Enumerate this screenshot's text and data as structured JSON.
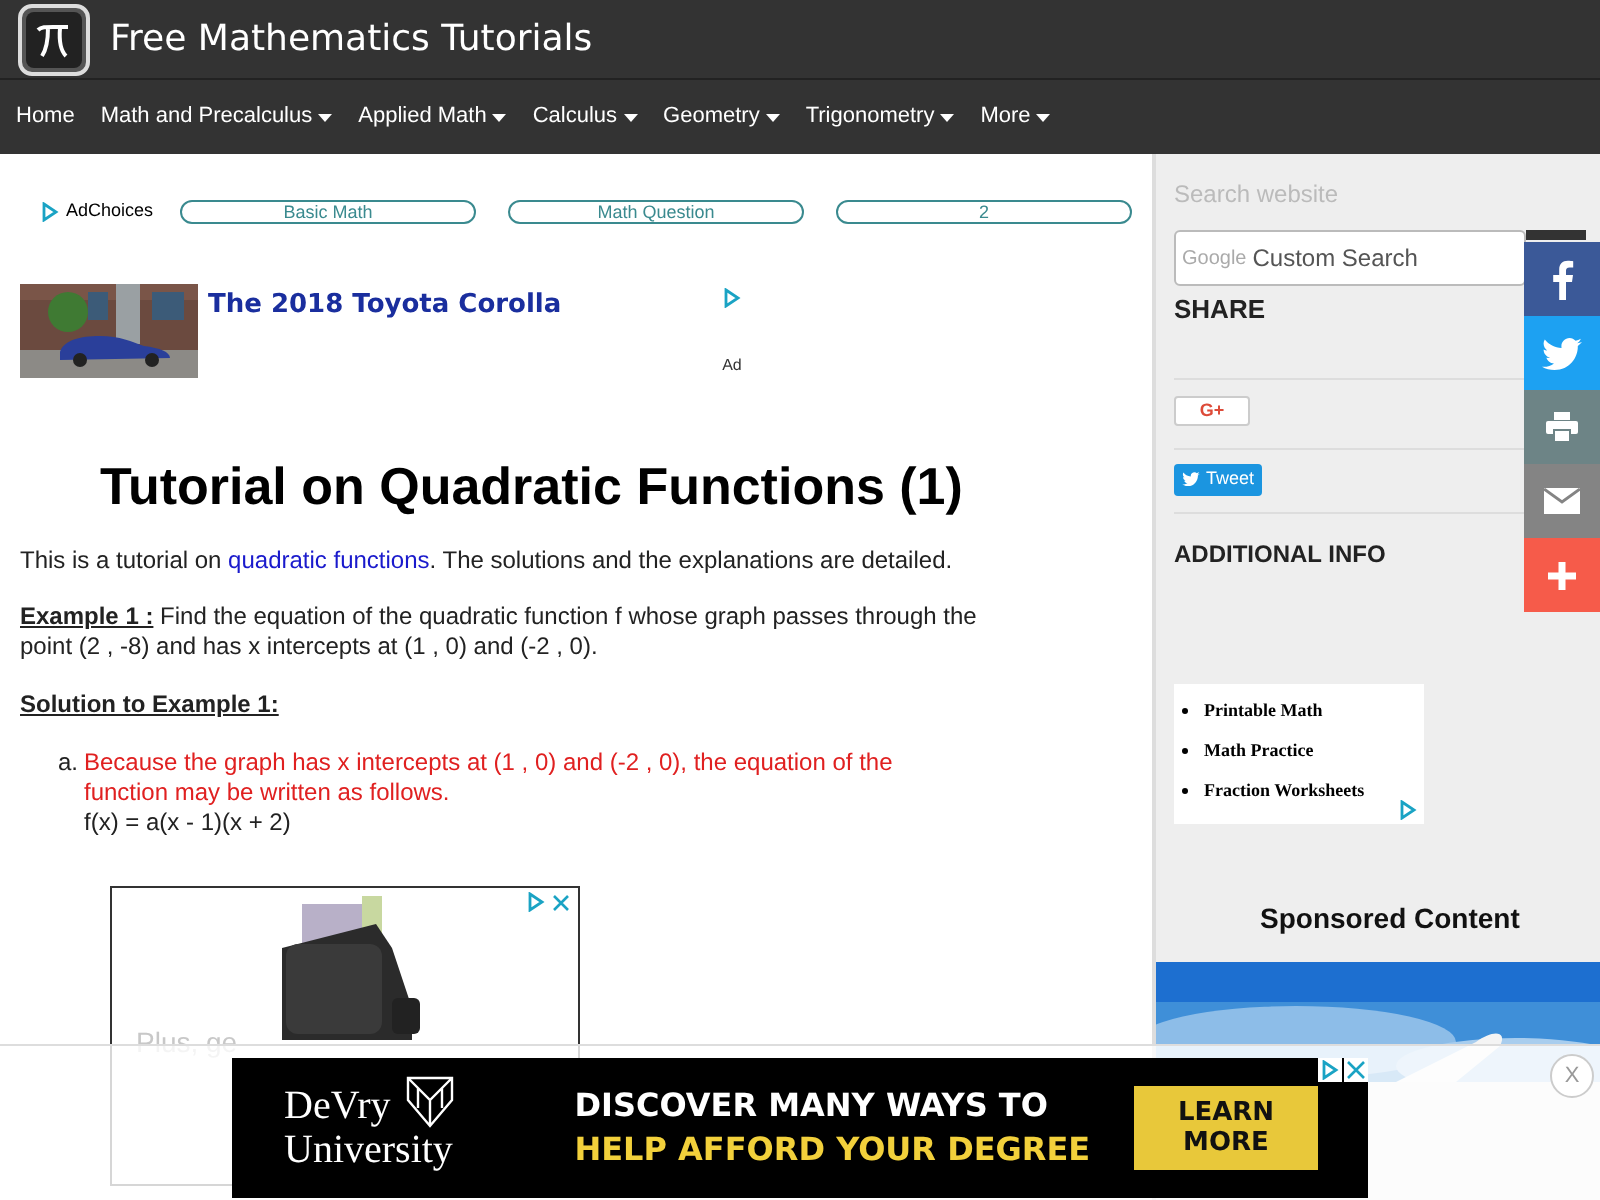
{
  "site": {
    "title": "Free Mathematics Tutorials"
  },
  "nav": [
    {
      "label": "Home",
      "dropdown": false
    },
    {
      "label": "Math and Precalculus",
      "dropdown": true
    },
    {
      "label": "Applied Math",
      "dropdown": true
    },
    {
      "label": "Calculus",
      "dropdown": true
    },
    {
      "label": "Geometry",
      "dropdown": true
    },
    {
      "label": "Trigonometry",
      "dropdown": true
    },
    {
      "label": "More",
      "dropdown": true
    }
  ],
  "ad_links": {
    "adchoices": "AdChoices",
    "links": [
      "Basic Math",
      "Math Question",
      "2"
    ]
  },
  "car_ad": {
    "title": "The 2018 Toyota Corolla",
    "ad_label": "Ad"
  },
  "article": {
    "title": "Tutorial on Quadratic Functions (1)",
    "intro": [
      {
        "text": "This is a tutorial on ",
        "link": false
      },
      {
        "text": "quadratic functions",
        "link": true
      },
      {
        "text": ". The solutions and the explanations are detailed.",
        "link": false
      }
    ],
    "example_label": "Example 1 :",
    "example_text": " Find the equation of the quadratic function f whose graph passes through the point (2 , -8) and has x intercepts at (1 , 0) and (-2 , 0).",
    "solution_heading": "Solution to Example 1:",
    "steps": [
      {
        "marker": "a.",
        "text": "Because the graph has x intercepts at (1 , 0) and (-2 , 0), the equation of the function may be written as follows.",
        "formula": "f(x) = a(x - 1)(x + 2)"
      }
    ],
    "faded_text": "Plus, ge"
  },
  "sidebar": {
    "search_label": "Search website",
    "search_brand": "Google",
    "search_placeholder": "Custom Search",
    "share_title": "SHARE",
    "gplus": "G+",
    "tweet": "Tweet",
    "additional_info": "ADDITIONAL INFO",
    "ad_items": [
      "Printable Math",
      "Math Practice",
      "Fraction Worksheets"
    ],
    "sponsored_title": "Sponsored Content"
  },
  "social": [
    {
      "kind": "facebook",
      "color": "#3b5998"
    },
    {
      "kind": "twitter",
      "color": "#1da1f2"
    },
    {
      "kind": "print",
      "color": "#6d8486"
    },
    {
      "kind": "email",
      "color": "#848484"
    },
    {
      "kind": "more",
      "color": "#f65b4a"
    }
  ],
  "bottom_ad": {
    "brand_line1": "DeVry",
    "brand_line2": "University",
    "headline1": "DISCOVER MANY WAYS TO",
    "headline2": "HELP AFFORD YOUR DEGREE",
    "cta": "LEARN MORE",
    "close": "X"
  }
}
